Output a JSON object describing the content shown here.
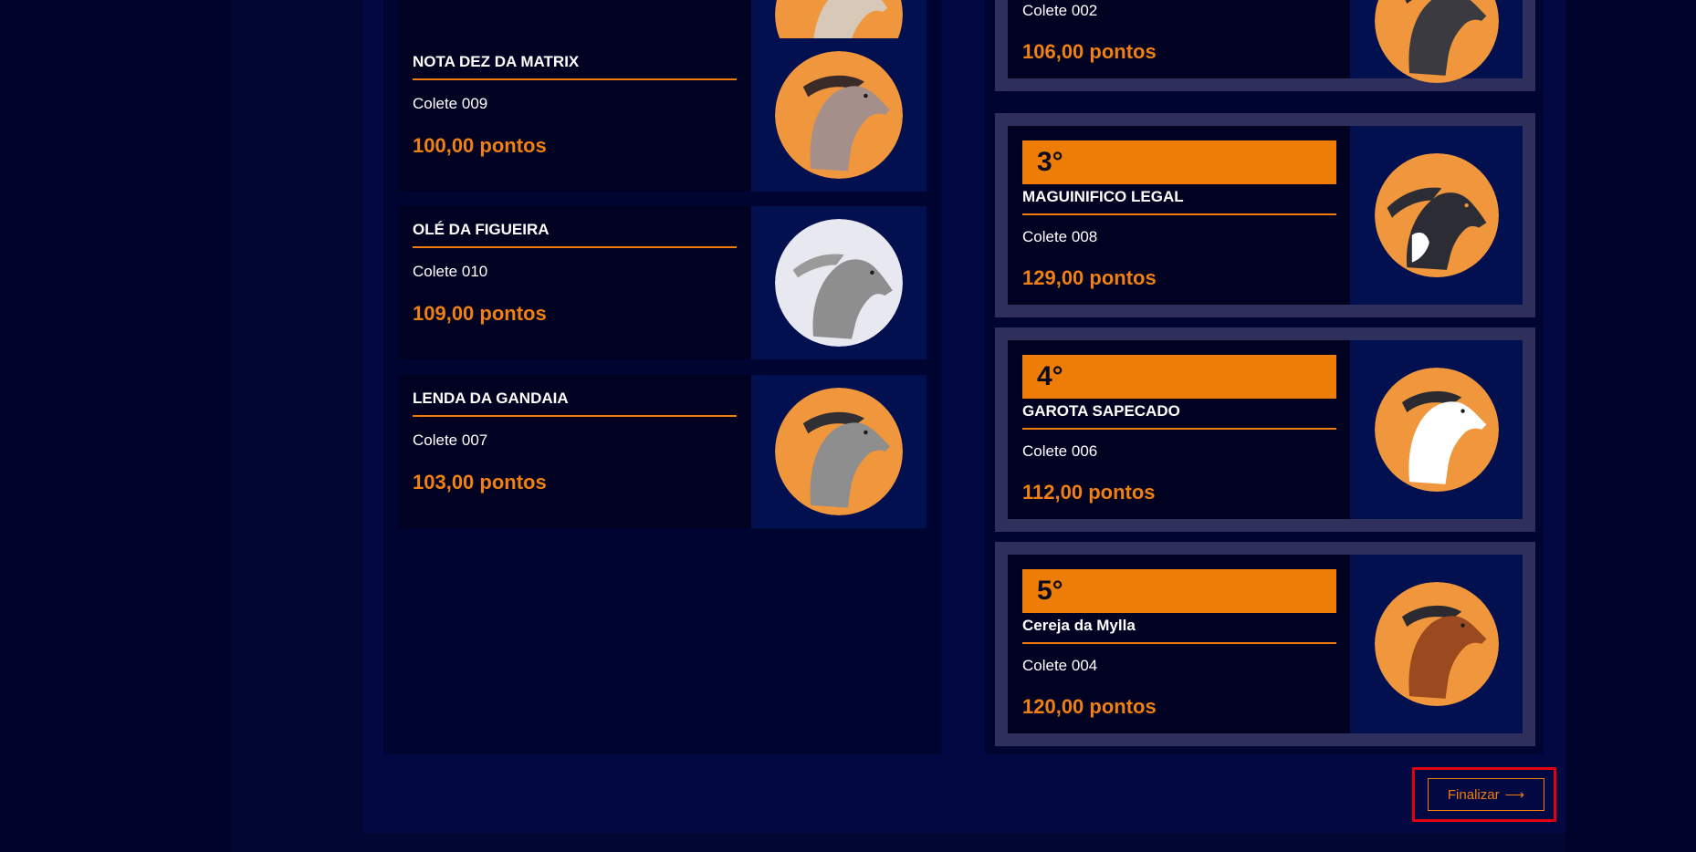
{
  "left_list": [
    {
      "name": "NOTA DEZ DA MATRIX",
      "colete": "Colete 009",
      "points": "100,00 pontos",
      "horse_icon": "horse-head-icon",
      "horse_color": "#a58f8a",
      "bg_color": "#f0963c"
    },
    {
      "name": "OLÉ DA FIGUEIRA",
      "colete": "Colete 010",
      "points": "109,00 pontos",
      "horse_icon": "horse-head-icon",
      "horse_color": "#8e8e8e",
      "bg_color": "#e8e8f0"
    },
    {
      "name": "LENDA DA GANDAIA",
      "colete": "Colete 007",
      "points": "103,00 pontos",
      "horse_icon": "horse-head-icon",
      "horse_color": "#8e8e8e",
      "bg_color": "#f0963c"
    }
  ],
  "partial_top_right": {
    "colete": "Colete 002",
    "points": "106,00 pontos"
  },
  "ranking": [
    {
      "rank": "3°",
      "name": "MAGUINIFICO LEGAL",
      "colete": "Colete 008",
      "points": "129,00 pontos",
      "horse_icon": "horse-head-icon",
      "horse_color": "#2c2c34",
      "bg_color": "#f0963c"
    },
    {
      "rank": "4°",
      "name": "GAROTA SAPECADO",
      "colete": "Colete 006",
      "points": "112,00 pontos",
      "horse_icon": "horse-head-icon",
      "horse_color": "#ffffff",
      "bg_color": "#f0963c"
    },
    {
      "rank": "5°",
      "name": "Cereja da Mylla",
      "colete": "Colete 004",
      "points": "120,00 pontos",
      "horse_icon": "horse-head-icon",
      "horse_color": "#9a4a1e",
      "bg_color": "#f0963c"
    }
  ],
  "footer": {
    "finalize_label": "Finalizar",
    "arrow": "⟶"
  },
  "colors": {
    "accent": "#ee7d07",
    "page_bg": "#00032b",
    "panel_bg": "#020942",
    "highlight": "#e00010"
  }
}
